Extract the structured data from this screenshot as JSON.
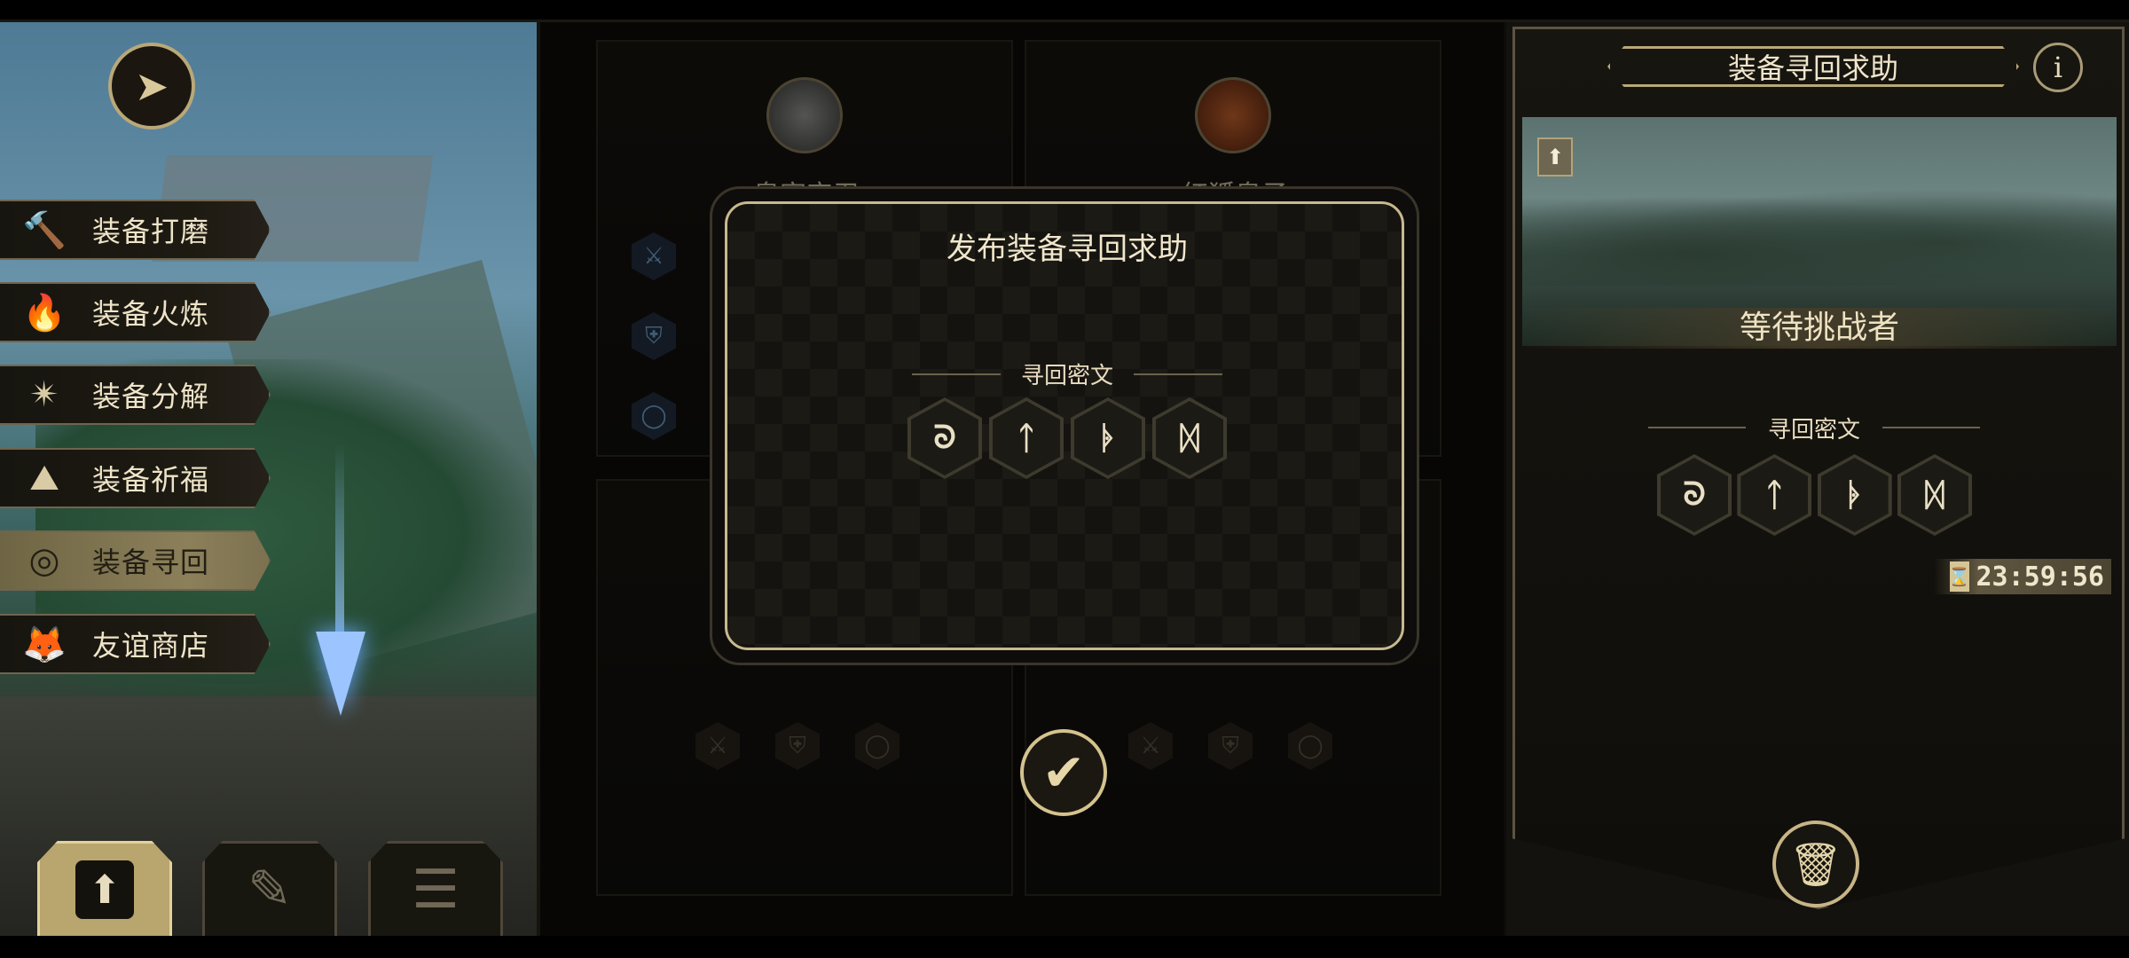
{
  "menu": {
    "items": [
      {
        "label": "装备打磨",
        "icon": "hammer-icon",
        "glyph": "🔨"
      },
      {
        "label": "装备火炼",
        "icon": "flame-icon",
        "glyph": "🔥"
      },
      {
        "label": "装备分解",
        "icon": "shatter-icon",
        "glyph": "✴"
      },
      {
        "label": "装备祈福",
        "icon": "pray-icon",
        "glyph": "⛰"
      },
      {
        "label": "装备寻回",
        "icon": "target-icon",
        "glyph": "◎"
      },
      {
        "label": "友谊商店",
        "icon": "fox-icon",
        "glyph": "🦊"
      }
    ],
    "active_index": 4
  },
  "bottom_buttons": [
    {
      "icon": "upload-icon",
      "glyph": "⬆"
    },
    {
      "icon": "feather-icon",
      "glyph": "✎"
    },
    {
      "icon": "list-icon",
      "glyph": "☰"
    }
  ],
  "cards": [
    {
      "name": "皇家守卫"
    },
    {
      "name": "红狐皇子"
    }
  ],
  "dialog": {
    "title": "发布装备寻回求助",
    "cipher_label": "寻回密文",
    "runes": [
      "ᘐ",
      "ᛏ",
      "ᚧ",
      "ᛞ"
    ]
  },
  "right_panel": {
    "title": "装备寻回求助",
    "info_label": "i",
    "status": "等待挑战者",
    "cipher_label": "寻回密文",
    "runes": [
      "ᘐ",
      "ᛏ",
      "ᚧ",
      "ᛞ"
    ],
    "timer": "23:59:56"
  },
  "colors": {
    "accent": "#c8b98e",
    "active_menu": "#8c805a",
    "background": "#0d0c0a"
  }
}
